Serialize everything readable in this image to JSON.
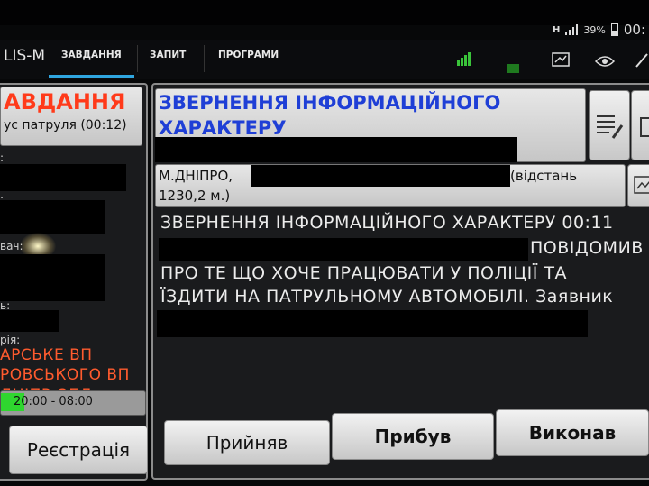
{
  "status": {
    "network": "H",
    "battery": "39%",
    "time": "00:"
  },
  "app": {
    "name": "LIS-M"
  },
  "tabs": [
    {
      "label": "ЗАВДАННЯ",
      "active": true
    },
    {
      "label": "ЗАПИТ",
      "active": false
    },
    {
      "label": "ПРОГРАМИ",
      "active": false
    }
  ],
  "toolbar_icons": [
    "signal-bars-icon",
    "green-indicator-icon",
    "map-icon",
    "eye-icon",
    "pencil-icon"
  ],
  "left_panel": {
    "title": "АВДАННЯ",
    "subtitle": "ус патруля (00:12)",
    "labels": [
      ":",
      ":",
      "вач:",
      "ь:",
      "рія:"
    ],
    "org_lines": [
      "АРСЬКЕ ВП",
      "РОВСЬКОГО ВП",
      "ДНІПР ОБЛ."
    ],
    "shift": "20:00 - 08:00",
    "register_button": "Реєстрація"
  },
  "detail": {
    "title_line1": "ЗВЕРНЕННЯ ІНФОРМАЦІЙНОГО",
    "title_line2": "ХАРАКТЕРУ",
    "address_prefix": "М.ДНІПРО,",
    "address_suffix": "(відстань",
    "distance": "1230,2 м.)",
    "message_lines": [
      "ЗВЕРНЕННЯ ІНФОРМАЦІЙНОГО ХАРАКТЕРУ 00:11",
      "ПОВІДОМИВ",
      "ПРО ТЕ ЩО ХОЧЕ ПРАЦЮВАТИ У ПОЛІЦІЇ ТА",
      "ЇЗДИТИ НА ПАТРУЛЬНОМУ АВТОМОБІЛІ. Заявник"
    ]
  },
  "buttons": {
    "accept": "Прийняв",
    "arrived": "Прибув",
    "done": "Виконав"
  },
  "colors": {
    "accent_tab": "#2fa6e0",
    "title_blue": "#1f3fd6",
    "left_title_red": "#ff3a1a",
    "orange_text": "#ff5b2e"
  }
}
